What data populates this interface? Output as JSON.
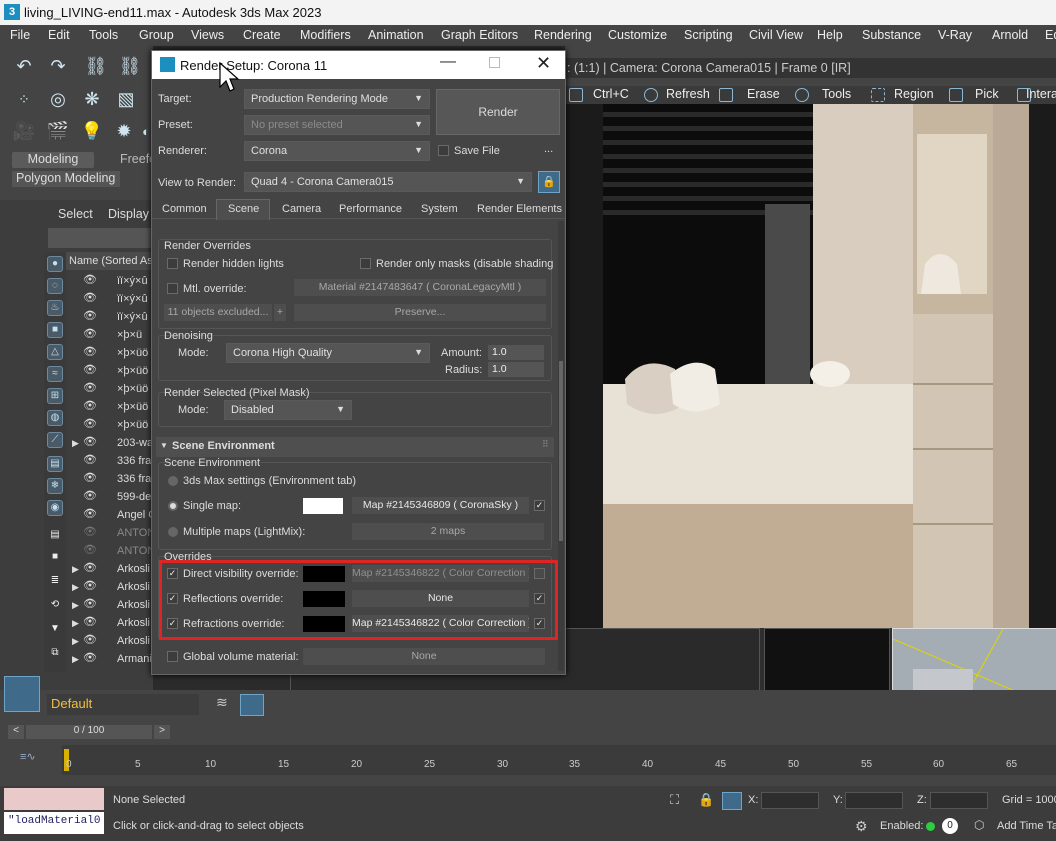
{
  "window": {
    "title": "living_LIVING-end11.max - Autodesk 3ds Max 2023",
    "app_icon": "3"
  },
  "menu": [
    "File",
    "Edit",
    "Tools",
    "Group",
    "Views",
    "Create",
    "Modifiers",
    "Animation",
    "Graph Editors",
    "Rendering",
    "Customize",
    "Scripting",
    "Civil View",
    "Help",
    "Substance",
    "V-Ray",
    "Arnold",
    "Ed"
  ],
  "ribbon": {
    "tab_modeling": "Modeling",
    "tab_freeform": "Freefo",
    "sub": "Polygon Modeling"
  },
  "scene_explorer": {
    "select": "Select",
    "display": "Display",
    "column": "Name (Sorted As",
    "rows": [
      "ïï×ý×û",
      "ïï×ý×û",
      "ïï×ý×û",
      "×þ×ü",
      "×þ×üö",
      "×þ×üö",
      "×þ×üö",
      "×þ×üö",
      "×þ×üö",
      "203-wa",
      "336 fra",
      "336 fra",
      "599-de",
      "Angel C",
      "ANTON",
      "ANTON",
      "Arkosli",
      "Arkosli",
      "Arkosli",
      "Arkosli",
      "Arkosli",
      "Armani"
    ]
  },
  "viewport": {
    "title": ": (1:1) | Camera: Corona Camera015 | Frame 0 [IR]",
    "toolbar": [
      "Ctrl+C",
      "Refresh",
      "Erase",
      "Tools",
      "Region",
      "Pick",
      "Intera"
    ]
  },
  "dialog": {
    "title": "Render Setup: Corona 11",
    "target_label": "Target:",
    "target": "Production Rendering Mode",
    "preset_label": "Preset:",
    "preset": "No preset selected",
    "renderer_label": "Renderer:",
    "renderer": "Corona",
    "save_file": "Save File",
    "more": "...",
    "view_label": "View to Render:",
    "view": "Quad 4 - Corona Camera015",
    "render_button": "Render",
    "tabs": [
      "Common",
      "Scene",
      "Camera",
      "Performance",
      "System",
      "Render Elements"
    ],
    "render_overrides": {
      "title": "Render Overrides",
      "hidden_lights": "Render hidden lights",
      "only_masks": "Render only masks (disable shading",
      "mtl_override": "Mtl. override:",
      "mtl_value": "Material #2147483647  ( CoronaLegacyMtl )",
      "excluded": "11 objects excluded...",
      "plus": "+",
      "preserve": "Preserve..."
    },
    "denoising": {
      "title": "Denoising",
      "mode_label": "Mode:",
      "mode": "Corona High Quality",
      "amount_label": "Amount:",
      "amount": "1.0",
      "radius_label": "Radius:",
      "radius": "1.0"
    },
    "pixel_mask": {
      "title": "Render Selected (Pixel Mask)",
      "mode_label": "Mode:",
      "mode": "Disabled"
    },
    "scene_env": {
      "header": "Scene Environment",
      "sub": "Scene Environment",
      "opt_3ds": "3ds Max settings (Environment tab)",
      "opt_single": "Single map:",
      "single_map": "Map #2145346809  ( CoronaSky )",
      "opt_multi": "Multiple maps (LightMix):",
      "multi_maps": "2 maps"
    },
    "overrides": {
      "title": "Overrides",
      "direct_label": "Direct visibility override:",
      "direct_map": "Map #2145346822  ( Color Correction )",
      "refl_label": "Reflections override:",
      "refl_map": "None",
      "refr_label": "Refractions override:",
      "refr_map": "Map #2145346822  ( Color Correction )",
      "global_label": "Global volume material:",
      "global_value": "None"
    }
  },
  "layer": {
    "name": "Default"
  },
  "timeline": {
    "frame": "0 / 100",
    "ticks": [
      "0",
      "5",
      "10",
      "15",
      "20",
      "25",
      "30",
      "35",
      "40",
      "45",
      "50",
      "55",
      "60",
      "65"
    ]
  },
  "status": {
    "script": "\"loadMaterial0",
    "selection": "None Selected",
    "hint": "Click or click-and-drag to select objects",
    "x_label": "X:",
    "y_label": "Y:",
    "z_label": "Z:",
    "grid": "Grid = 1000",
    "enabled": "Enabled:",
    "add_time_tag": "Add Time Ta"
  },
  "colors": {
    "highlight": "#e02424",
    "accent": "#5a8fc0"
  }
}
